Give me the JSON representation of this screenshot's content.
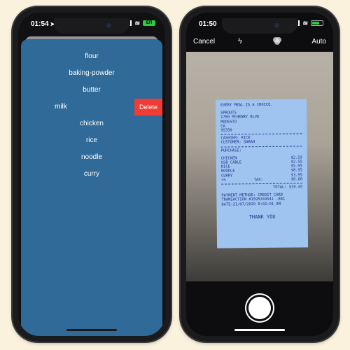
{
  "left_phone": {
    "status": {
      "time": "01:54",
      "battery": "EΠ"
    },
    "list_items": [
      {
        "label": "flour",
        "swiped": false
      },
      {
        "label": "baking-powder",
        "swiped": false
      },
      {
        "label": "butter",
        "swiped": false
      },
      {
        "label": "milk",
        "swiped": true,
        "action_label": "Delete"
      },
      {
        "label": "chicken",
        "swiped": false
      },
      {
        "label": "rice",
        "swiped": false
      },
      {
        "label": "noodle",
        "swiped": false
      },
      {
        "label": "curry",
        "swiped": false
      }
    ],
    "colors": {
      "sheet": "#2f6a98",
      "delete": "#f03c34"
    }
  },
  "right_phone": {
    "status": {
      "time": "01:50"
    },
    "topbar": {
      "cancel_label": "Cancel",
      "flash_icon": "flash-icon",
      "filter_icon": "filters-icon",
      "auto_label": "Auto"
    },
    "receipt": {
      "header": "EVERY MEAL IS A CHOICE.",
      "store_lines": [
        "SPROUTS",
        "1780 MCHENRY BLVD",
        "MODESTO",
        "CA",
        "95350"
      ],
      "cashier": "CASHIER: RICK",
      "customer": "CUSTOMER: SARAH",
      "purchase_label": "PURCHASE:",
      "items": [
        {
          "name": "CHICKEN",
          "price": "$2.59"
        },
        {
          "name": "USB CABLE",
          "price": "$2.55"
        },
        {
          "name": "RICE",
          "price": "$5.95"
        },
        {
          "name": "NOODLE",
          "price": "$8.95"
        },
        {
          "name": "CURRY",
          "price": "$3.95"
        }
      ],
      "tax_rate": "+%",
      "tax_label": "TAX:",
      "tax_value": "$0.00",
      "total": "TOTAL: $19.45",
      "payment": "PAYMENT METHOD: CREDIT CARD",
      "transaction": "TRANSACTION #1595344541 -881",
      "date": "DATE:21/07/2020 8:02:01 AM",
      "thanks": "THANK YOU"
    },
    "colors": {
      "receipt": "#9fc4ef",
      "ink": "#1d2f8a"
    }
  }
}
